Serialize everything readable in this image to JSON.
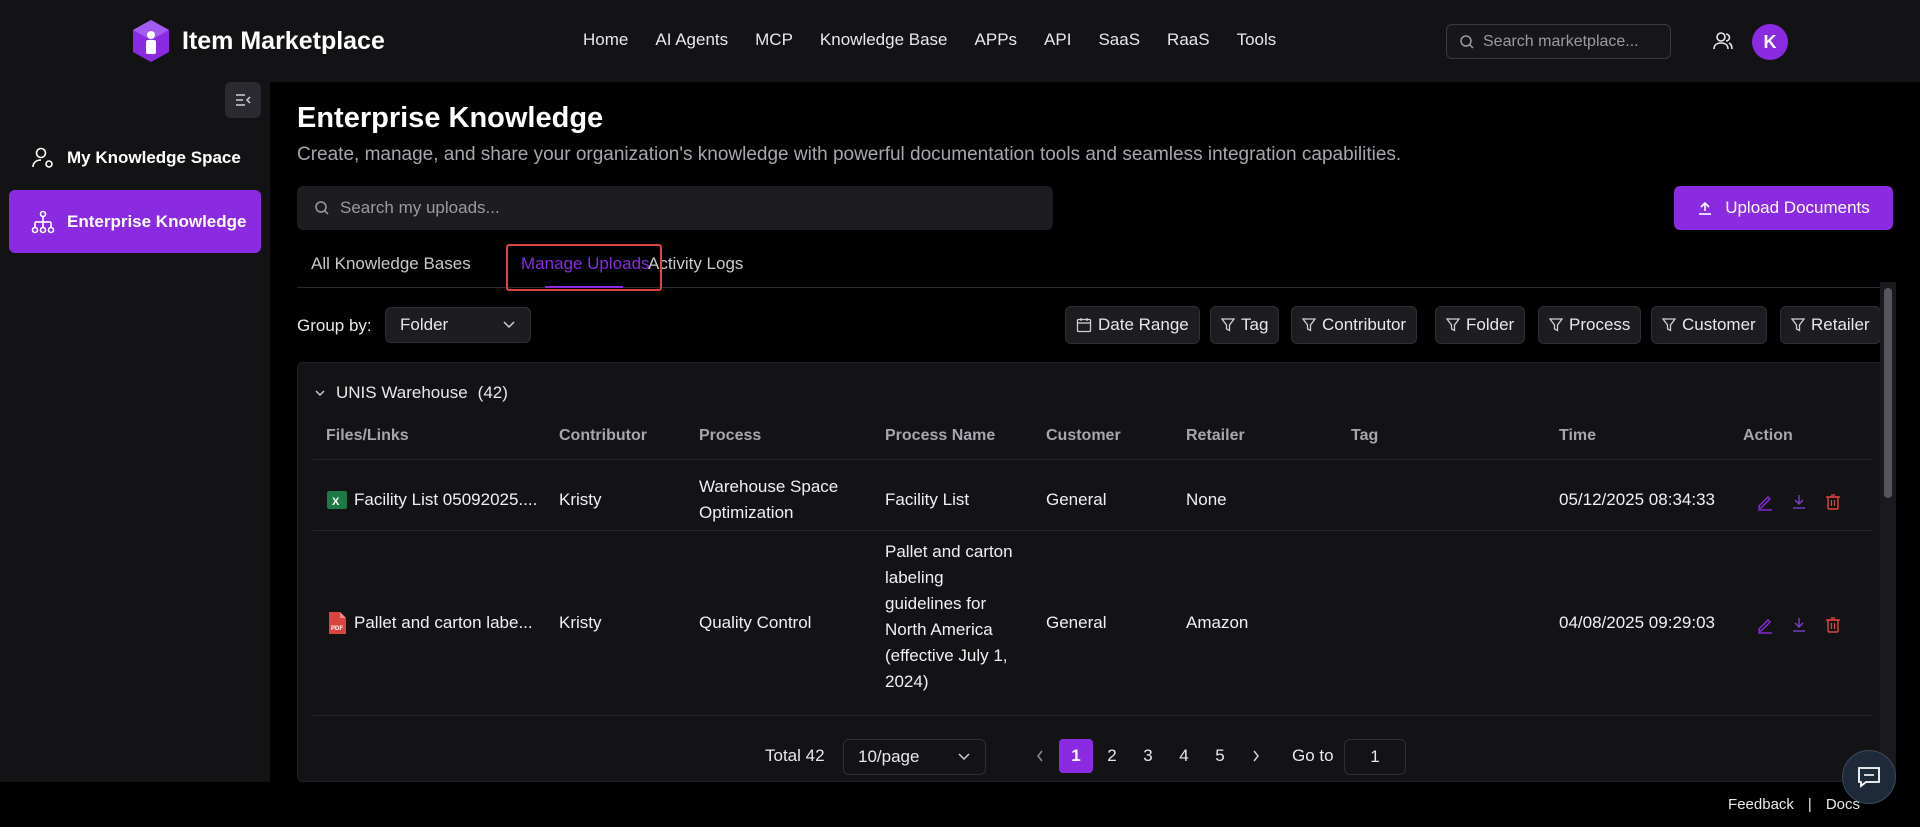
{
  "app": {
    "title": "Item Marketplace",
    "brand_color": "#8a2be2"
  },
  "nav": {
    "items": [
      "Home",
      "AI Agents",
      "MCP",
      "Knowledge Base",
      "APPs",
      "API",
      "SaaS",
      "RaaS",
      "Tools"
    ]
  },
  "top_search": {
    "placeholder": "Search marketplace..."
  },
  "user": {
    "avatar_letter": "K"
  },
  "sidebar": {
    "items": [
      {
        "label": "My Knowledge Space",
        "icon": "user-settings-icon",
        "active": false
      },
      {
        "label": "Enterprise Knowledge",
        "icon": "org-chart-icon",
        "active": true
      }
    ]
  },
  "page": {
    "title": "Enterprise Knowledge",
    "subtitle": "Create, manage, and share your organization's knowledge with powerful documentation tools and seamless integration capabilities.",
    "search_placeholder": "Search my uploads...",
    "upload_label": "Upload Documents"
  },
  "tabs": [
    {
      "label": "All Knowledge Bases",
      "active": false
    },
    {
      "label": "Manage Uploads",
      "active": true
    },
    {
      "label": "Activity Logs",
      "active": false
    }
  ],
  "group_by": {
    "label": "Group by:",
    "value": "Folder"
  },
  "filters": [
    "Date Range",
    "Tag",
    "Contributor",
    "Folder",
    "Process",
    "Customer",
    "Retailer"
  ],
  "group": {
    "name": "UNIS Warehouse",
    "count": "(42)"
  },
  "table": {
    "columns": [
      "Files/Links",
      "Contributor",
      "Process",
      "Process Name",
      "Customer",
      "Retailer",
      "Tag",
      "Time",
      "Action"
    ],
    "rows": [
      {
        "file": "Facility List 05092025....",
        "file_type": "excel",
        "contributor": "Kristy",
        "process_line1": "Warehouse Space",
        "process_line2": "Optimization",
        "process_name": "Facility List",
        "customer": "General",
        "retailer": "None",
        "tag": "",
        "time": "05/12/2025 08:34:33"
      },
      {
        "file": "Pallet and carton labe...",
        "file_type": "pdf",
        "contributor": "Kristy",
        "process": "Quality Control",
        "process_name_lines": [
          "Pallet and carton",
          "labeling",
          "guidelines for",
          "North America",
          "(effective July 1,",
          "2024)"
        ],
        "customer": "General",
        "retailer": "Amazon",
        "tag": "",
        "time": "04/08/2025 09:29:03"
      }
    ]
  },
  "pagination": {
    "total": "Total 42",
    "page_size": "10/page",
    "pages": [
      "1",
      "2",
      "3",
      "4",
      "5"
    ],
    "current": "1",
    "goto_label": "Go to",
    "goto_value": "1"
  },
  "footer": {
    "feedback": "Feedback",
    "separator": "|",
    "docs": "Docs"
  }
}
